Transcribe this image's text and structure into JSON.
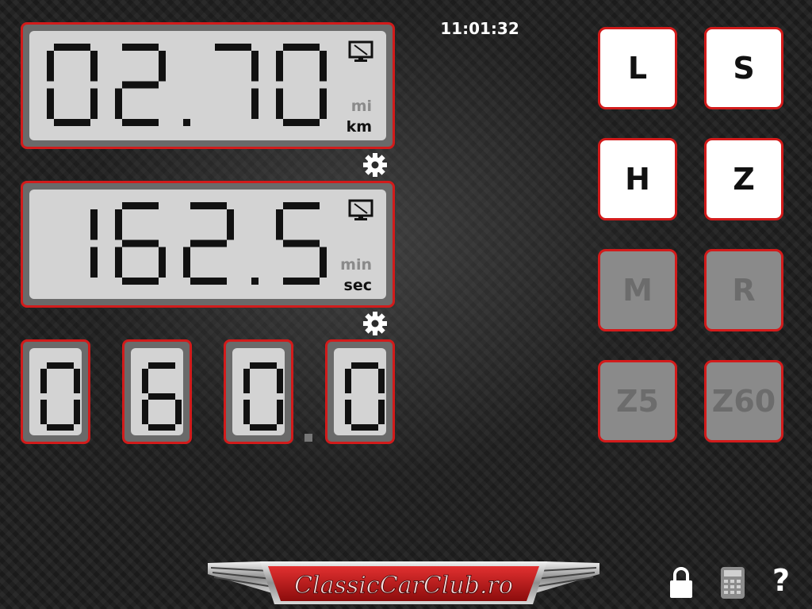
{
  "clock": {
    "time": "11:01:32"
  },
  "distance": {
    "value": "02.70",
    "unit_secondary": "mi",
    "unit_primary": "km",
    "icon": "monitor-icon"
  },
  "time_display": {
    "value": "162.5",
    "unit_secondary": "min",
    "unit_primary": "sec",
    "icon": "monitor-icon"
  },
  "speed_digits": [
    "0",
    "6",
    "0",
    "0"
  ],
  "buttons": [
    {
      "label": "L",
      "active": true
    },
    {
      "label": "S",
      "active": true
    },
    {
      "label": "H",
      "active": true
    },
    {
      "label": "Z",
      "active": true
    },
    {
      "label": "M",
      "active": false
    },
    {
      "label": "R",
      "active": false
    },
    {
      "label": "Z5",
      "active": false
    },
    {
      "label": "Z60",
      "active": false
    }
  ],
  "logo": {
    "text": "ClassicCarClub.ro"
  },
  "toolbar": {
    "icons": [
      "lock-icon",
      "calculator-icon",
      "help-icon"
    ],
    "help_label": "?"
  },
  "colors": {
    "accent": "#d21b1b",
    "lcd": "#d3d3d3",
    "segment": "#111111"
  }
}
